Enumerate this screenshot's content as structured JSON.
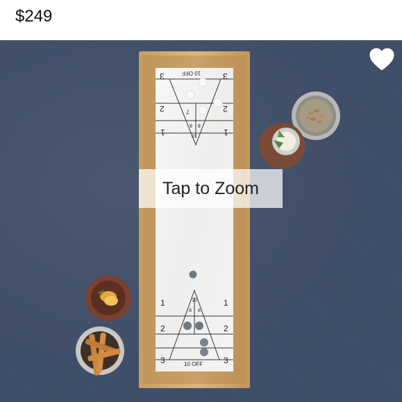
{
  "product": {
    "price": "$249"
  },
  "image": {
    "overlay_text": "Tap to Zoom",
    "board_labels": {
      "top_off": "10 OFF",
      "bottom_off": "10 OFF",
      "top_scores": [
        "3",
        "3",
        "2",
        "2",
        "1",
        "1"
      ],
      "top_triangle": [
        "7",
        "8",
        "8",
        "10"
      ],
      "bottom_scores": [
        "1",
        "1",
        "2",
        "2",
        "3",
        "3"
      ],
      "bottom_triangle": [
        "10",
        "8",
        "8",
        "7"
      ]
    }
  },
  "actions": {
    "favorite_icon": "heart-icon"
  },
  "colors": {
    "background": "#3e4d68",
    "board_frame": "#d8b27a",
    "marble": "#f3f3f1",
    "heart": "#ffffff"
  }
}
